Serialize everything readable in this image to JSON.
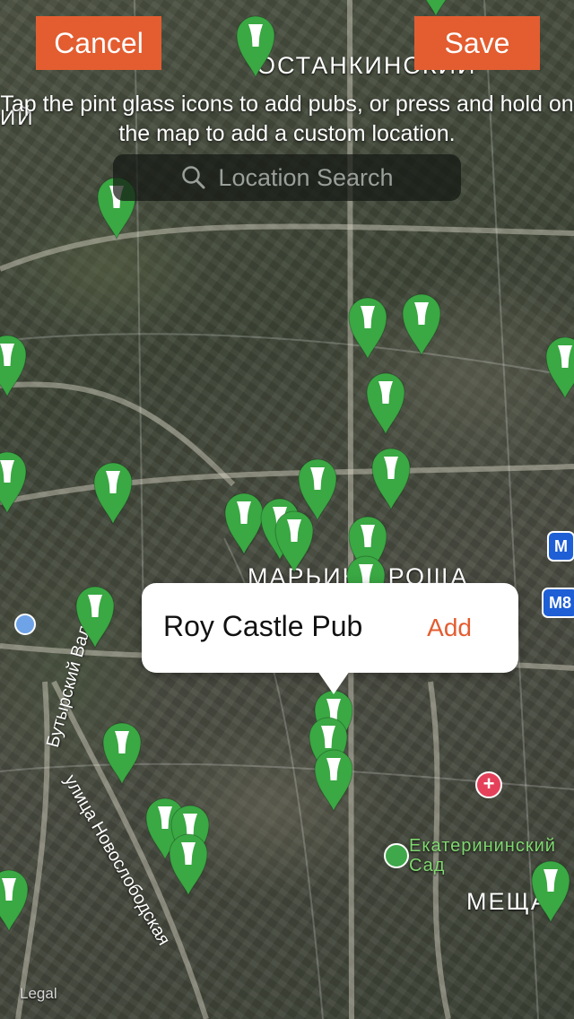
{
  "header": {
    "cancel_label": "Cancel",
    "save_label": "Save",
    "accent_color": "#e35d30"
  },
  "instructions": "Tap the pint glass icons to add pubs, or press and hold on the map to add a custom location.",
  "search": {
    "placeholder": "Location Search",
    "icon": "search-icon"
  },
  "map": {
    "marker_icon": "pint-glass-icon",
    "marker_color": "#3aa843",
    "labels": {
      "district_top": "ОСТАНКИНСКИЙ",
      "district_middle": "МАРЬИНА РОЩА",
      "district_bottom": "МЕЩА",
      "street_1": "улица Новослободская",
      "street_2": "Бутырский Вал",
      "park": "Екатерининский Сад",
      "left_edge": "ИЙ",
      "legal": "Legal"
    },
    "badges": [
      "M",
      "M8"
    ]
  },
  "callout": {
    "title": "Roy Castle Pub",
    "add_label": "Add"
  }
}
